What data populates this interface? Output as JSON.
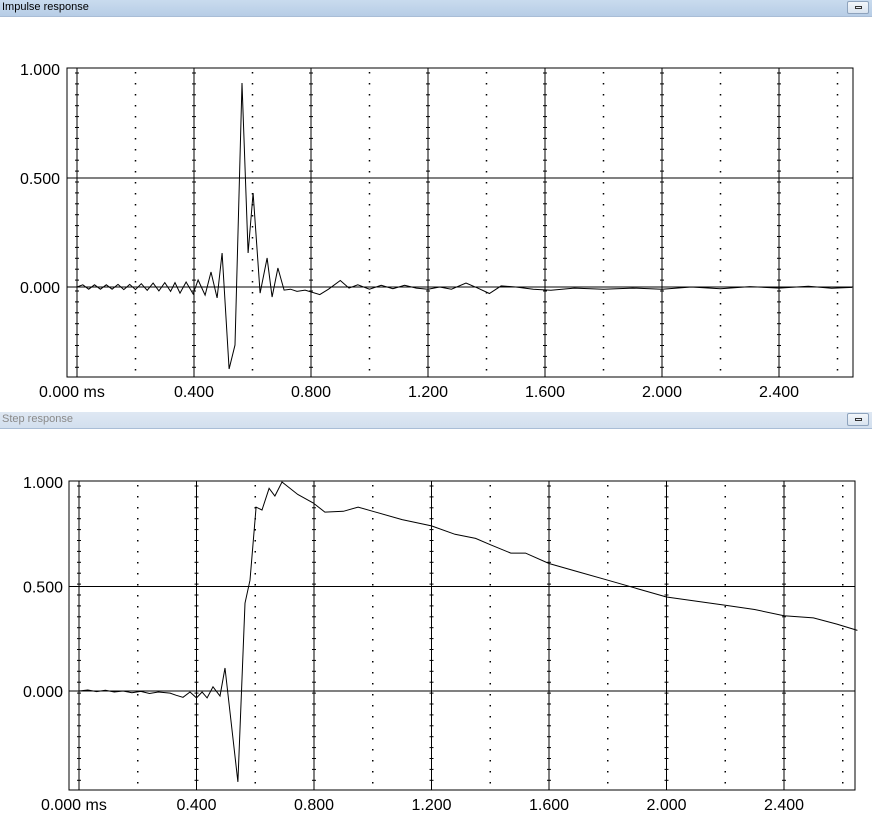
{
  "windows": {
    "impulse": {
      "title": "Impulse response"
    },
    "step": {
      "title": "Step response"
    }
  },
  "chart_data": [
    {
      "type": "line",
      "title": "Impulse response",
      "xlabel": "ms",
      "xlim": [
        0,
        2.65
      ],
      "ylim": [
        -0.413,
        1.0
      ],
      "x_ticks": [
        0,
        0.4,
        0.8,
        1.2,
        1.6,
        2.0,
        2.4
      ],
      "x_tick_labels": [
        "0.000 ms",
        "0.400",
        "0.800",
        "1.200",
        "1.600",
        "2.000",
        "2.400"
      ],
      "y_ticks": [
        0,
        0.5,
        1.0
      ],
      "y_tick_labels": [
        "0.000",
        "0.500",
        "1.000"
      ],
      "grid": true,
      "points": [
        [
          0,
          0
        ],
        [
          0.02,
          0.01
        ],
        [
          0.04,
          -0.01
        ],
        [
          0.06,
          0.01
        ],
        [
          0.08,
          -0.01
        ],
        [
          0.1,
          0.01
        ],
        [
          0.12,
          -0.01
        ],
        [
          0.14,
          0.012
        ],
        [
          0.16,
          -0.012
        ],
        [
          0.18,
          0.012
        ],
        [
          0.2,
          -0.012
        ],
        [
          0.22,
          0.015
        ],
        [
          0.24,
          -0.015
        ],
        [
          0.26,
          0.018
        ],
        [
          0.28,
          -0.018
        ],
        [
          0.3,
          0.02
        ],
        [
          0.32,
          -0.02
        ],
        [
          0.335,
          0.02
        ],
        [
          0.352,
          -0.028
        ],
        [
          0.373,
          0.023
        ],
        [
          0.397,
          -0.032
        ],
        [
          0.414,
          0.032
        ],
        [
          0.438,
          -0.037
        ],
        [
          0.458,
          0.069
        ],
        [
          0.479,
          -0.05
        ],
        [
          0.496,
          0.156
        ],
        [
          0.52,
          -0.376
        ],
        [
          0.54,
          -0.266
        ],
        [
          0.564,
          0.936
        ],
        [
          0.585,
          0.156
        ],
        [
          0.602,
          0.431
        ],
        [
          0.615,
          0.183
        ],
        [
          0.626,
          -0.028
        ],
        [
          0.65,
          0.133
        ],
        [
          0.667,
          -0.046
        ],
        [
          0.687,
          0.087
        ],
        [
          0.708,
          -0.014
        ],
        [
          0.73,
          -0.01
        ],
        [
          0.752,
          -0.02
        ],
        [
          0.78,
          -0.014
        ],
        [
          0.83,
          -0.035
        ],
        [
          0.86,
          -0.01
        ],
        [
          0.9,
          0.03
        ],
        [
          0.93,
          -0.005
        ],
        [
          0.96,
          0.01
        ],
        [
          1.0,
          -0.01
        ],
        [
          1.04,
          0.008
        ],
        [
          1.08,
          -0.008
        ],
        [
          1.12,
          0.008
        ],
        [
          1.16,
          -0.005
        ],
        [
          1.2,
          -0.01
        ],
        [
          1.24,
          0.0
        ],
        [
          1.28,
          -0.01
        ],
        [
          1.33,
          0.018
        ],
        [
          1.37,
          -0.005
        ],
        [
          1.41,
          -0.03
        ],
        [
          1.45,
          0.005
        ],
        [
          1.5,
          0.0
        ],
        [
          1.56,
          -0.01
        ],
        [
          1.62,
          -0.015
        ],
        [
          1.7,
          -0.005
        ],
        [
          1.8,
          -0.01
        ],
        [
          1.9,
          -0.005
        ],
        [
          2.0,
          -0.01
        ],
        [
          2.1,
          0.0
        ],
        [
          2.2,
          -0.008
        ],
        [
          2.3,
          0.002
        ],
        [
          2.4,
          -0.005
        ],
        [
          2.5,
          0.003
        ],
        [
          2.58,
          -0.006
        ],
        [
          2.65,
          -0.002
        ]
      ]
    },
    {
      "type": "line",
      "title": "Step response",
      "xlabel": "ms",
      "xlim": [
        0,
        2.65
      ],
      "ylim": [
        -0.475,
        1.0
      ],
      "x_ticks": [
        0,
        0.4,
        0.8,
        1.2,
        1.6,
        2.0,
        2.4
      ],
      "x_tick_labels": [
        "0.000 ms",
        "0.400",
        "0.800",
        "1.200",
        "1.600",
        "2.000",
        "2.400"
      ],
      "y_ticks": [
        0,
        0.5,
        1.0
      ],
      "y_tick_labels": [
        "0.000",
        "0.500",
        "1.000"
      ],
      "grid": true,
      "points": [
        [
          0,
          0
        ],
        [
          0.03,
          0.005
        ],
        [
          0.06,
          -0.003
        ],
        [
          0.09,
          0.004
        ],
        [
          0.12,
          -0.005
        ],
        [
          0.15,
          0.0
        ],
        [
          0.18,
          -0.008
        ],
        [
          0.21,
          -0.002
        ],
        [
          0.24,
          -0.012
        ],
        [
          0.27,
          -0.005
        ],
        [
          0.31,
          -0.01
        ],
        [
          0.33,
          -0.02
        ],
        [
          0.354,
          -0.03
        ],
        [
          0.378,
          -0.005
        ],
        [
          0.4,
          -0.033
        ],
        [
          0.419,
          -0.005
        ],
        [
          0.436,
          -0.033
        ],
        [
          0.456,
          0.02
        ],
        [
          0.48,
          -0.024
        ],
        [
          0.497,
          0.11
        ],
        [
          0.541,
          -0.435
        ],
        [
          0.565,
          0.42
        ],
        [
          0.582,
          0.53
        ],
        [
          0.603,
          0.88
        ],
        [
          0.623,
          0.866
        ],
        [
          0.647,
          0.97
        ],
        [
          0.667,
          0.933
        ],
        [
          0.691,
          1.0
        ],
        [
          0.745,
          0.94
        ],
        [
          0.797,
          0.9
        ],
        [
          0.837,
          0.856
        ],
        [
          0.9,
          0.86
        ],
        [
          0.95,
          0.88
        ],
        [
          1.0,
          0.86
        ],
        [
          1.1,
          0.82
        ],
        [
          1.2,
          0.79
        ],
        [
          1.28,
          0.75
        ],
        [
          1.35,
          0.73
        ],
        [
          1.4,
          0.7
        ],
        [
          1.47,
          0.66
        ],
        [
          1.52,
          0.66
        ],
        [
          1.6,
          0.61
        ],
        [
          1.7,
          0.57
        ],
        [
          1.8,
          0.53
        ],
        [
          1.9,
          0.49
        ],
        [
          2.0,
          0.45
        ],
        [
          2.1,
          0.43
        ],
        [
          2.2,
          0.41
        ],
        [
          2.3,
          0.39
        ],
        [
          2.4,
          0.36
        ],
        [
          2.5,
          0.35
        ],
        [
          2.58,
          0.32
        ],
        [
          2.65,
          0.29
        ]
      ]
    }
  ]
}
